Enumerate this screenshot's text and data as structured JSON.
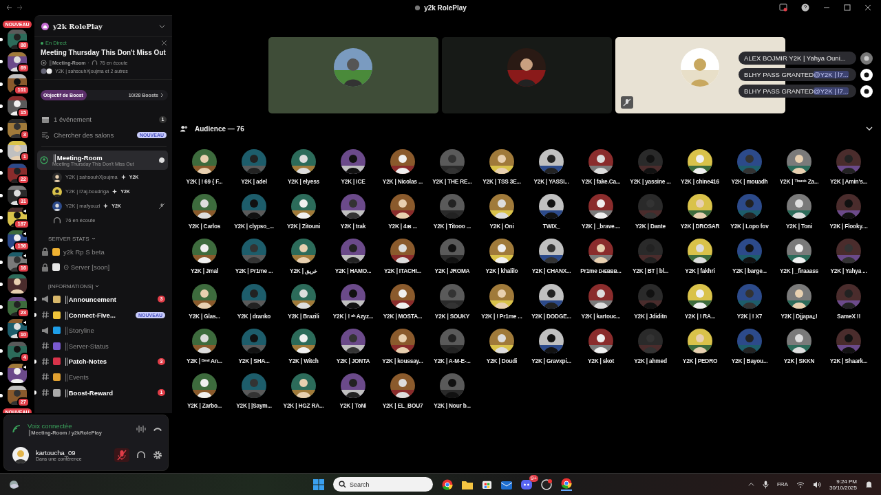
{
  "window": {
    "title": "y2k RolePlay"
  },
  "servers": {
    "top_badge": "NOUVEAU",
    "bottom_badge": "NOUVEAU",
    "items": [
      {
        "badge": "88",
        "unread": true,
        "voice": false
      },
      {
        "badge": "69",
        "unread": true,
        "voice": false
      },
      {
        "badge": "101",
        "unread": true,
        "voice": false
      },
      {
        "badge": "15",
        "unread": true,
        "voice": false
      },
      {
        "badge": "3",
        "unread": true,
        "voice": false
      },
      {
        "badge": "1",
        "unread": true,
        "voice": false
      },
      {
        "badge": "22",
        "unread": true,
        "voice": false
      },
      {
        "badge": "31",
        "unread": true,
        "voice": false
      },
      {
        "badge": "187",
        "unread": true,
        "voice": true
      },
      {
        "badge": "156",
        "unread": true,
        "voice": true
      },
      {
        "badge": "16",
        "unread": true,
        "voice": true
      },
      {
        "unread": true,
        "voice": false
      },
      {
        "badge": "23",
        "unread": true,
        "voice": false
      },
      {
        "badge": "10",
        "unread": true,
        "voice": true
      },
      {
        "badge": "4",
        "unread": true,
        "voice": false
      },
      {
        "unread": true,
        "voice": true
      },
      {
        "badge": "27",
        "unread": true,
        "voice": false
      }
    ]
  },
  "server": {
    "name": "y2k RolePlay"
  },
  "live_event": {
    "status": "En Direct",
    "title": "Meeting Thursday This Don't Miss Out",
    "channel": "║Meeting-Room",
    "separator": "·",
    "listeners": "76 en écoute",
    "participants": "Y2K | sahsouhXjoujma et 2 autres"
  },
  "boost": {
    "label": "Objectif de Boost",
    "level": 0.36,
    "count": "10/28 Boosts"
  },
  "shortcuts": [
    {
      "kind": "events",
      "label": "1 événement",
      "badge": "1"
    },
    {
      "kind": "search",
      "label": "Chercher des salons",
      "badge": "NOUVEAU"
    }
  ],
  "voice_channel": {
    "name": "║Meeting-Room",
    "topic": "Meeting Thursday This Don't Miss Out",
    "selected": true,
    "listeners": "76 en écoute",
    "members": [
      {
        "name": "Y2K | sahsouhXjoujma",
        "tag": "Y2K",
        "muted": false
      },
      {
        "name": "Y2K | l7aj.boudriga",
        "tag": "Y2K",
        "muted": false
      },
      {
        "name": "Y2K | mafyouzi",
        "tag": "Y2K",
        "muted": true
      }
    ]
  },
  "categories": [
    {
      "name": "SERVER STATS",
      "channels": [
        {
          "kind": "locked",
          "name": "y2k Rp S beta",
          "unread": false
        },
        {
          "kind": "locked",
          "name": "⊙ Server [soon]",
          "unread": false
        }
      ]
    },
    {
      "name": "[INFORMATIONS]",
      "channels": [
        {
          "kind": "announcement",
          "name": "║Announcement",
          "unread": true,
          "badge": {
            "kind": "count",
            "text": "3"
          }
        },
        {
          "kind": "text",
          "name": "║Connect-Five...",
          "unread": true,
          "badge": {
            "kind": "new",
            "text": "NOUVEAU"
          }
        },
        {
          "kind": "announcement",
          "name": "║Storyline",
          "unread": false
        },
        {
          "kind": "text",
          "name": "║Server-Status",
          "unread": false
        },
        {
          "kind": "text",
          "name": "║Patch-Notes",
          "unread": true,
          "badge": {
            "kind": "count",
            "text": "3"
          }
        },
        {
          "kind": "text",
          "name": "║Events",
          "unread": false
        },
        {
          "kind": "text",
          "name": "║Boost-Reward",
          "unread": true,
          "badge": {
            "kind": "count",
            "text": "1"
          }
        }
      ]
    }
  ],
  "voice_panel": {
    "status": "Voix connectée",
    "location": "║Meeting-Room / y2kRolePlay"
  },
  "user": {
    "name": "kartoucha_09",
    "status": "Dans une conférence",
    "mic_muted": true
  },
  "stage_tiles": [
    {
      "kind": "picture",
      "muted": false
    },
    {
      "kind": "picture",
      "muted": false
    },
    {
      "kind": "picture",
      "muted": true
    }
  ],
  "notifications": [
    {
      "text": "ALEX BOJMIR Y2K | Yahya Ouni..."
    },
    {
      "text": "BLHY PASS GRANTED",
      "mention": "@Y2K | l7..."
    },
    {
      "text": "BLHY PASS GRANTED",
      "mention": "@Y2K | l7..."
    }
  ],
  "audience": {
    "title": "Audience — 76",
    "members": [
      "Y2K | ! 69 { F...",
      "Y2K | adel",
      "Y2K | elyess",
      "Y2K | ICE",
      "Y2K | Nicolas ...",
      "Y2K | THE RE...",
      "Y2K | TSS 3E...",
      "Y2K | YASSI...",
      "Y2K | fake.Ca...",
      "Y2K | yassine ...",
      "Y2K | chine416",
      "Y2K | mouadh",
      "Y2K | ᵀʰᵃʳᵉᵇ Za...",
      "Y2K | Amin's...",
      "Y2K | Carlos",
      "Y2K | clypso_...",
      "Y2K | Zitouni",
      "Y2K | trak",
      "Y2K | 4ıв ...",
      "Y2K | Titooo ...",
      "Y2K | Oni",
      "TWIX_",
      "Y2K | _brave....",
      "Y2K | Dante",
      "Y2K | DROSAR",
      "Y2K | Lopo fov",
      "Y2K | Toni",
      "Y2K | Flooky....",
      "Y2K | Jmal",
      "Y2K | Pr1me ...",
      "Y2K | خريق",
      "Y2K | HAMO...",
      "Y2K | ITACHI...",
      "Y2K | JROMA",
      "Y2K | khalilo",
      "Y2K | CHANX...",
      "Pr1me ɪʜᴇʙʙʙ...",
      "Y2K | BT | bl...",
      "Y2K | fakhri",
      "Y2K | barge...",
      "Y2K | _firaaass",
      "Y2K | Yahya ...",
      "Y2K | Glas...",
      "Y2K | dranko",
      "Y2K | Brazili",
      "Y2K | ! ᵃʰ Azyz...",
      "Y2K | MOSTA...",
      "Y2K | SOUKY",
      "Y2K | ! Pr1me ...",
      "Y2K | DODGE...",
      "Y2K | kartouc...",
      "Y2K | Jdiditn",
      "Y2K | ! RA...",
      "Y2K | ! X7",
      "Y2K | Djjapa¿!",
      "SameX !!",
      "Y2K | ᴰᵉᵛᶦˡ An...",
      "Y2K | SHA...",
      "Y2K | Witch",
      "Y2K | JONTA",
      "Y2K | koussay...",
      "Y2K | A-M-E-...",
      "Y2K | Doudi",
      "Y2K | Gravxpi...",
      "Y2K | skot",
      "Y2K | ahmed",
      "Y2K | PEDRO",
      "Y2K | Bayou...",
      "Y2K | SKKN",
      "Y2K | Shaark...",
      "Y2K | Zarbo...",
      "Y2K | |Saym...",
      "Y2K | HGZ RA...",
      "Y2K | ToNi",
      "Y2K | EL_BOU7",
      "Y2K | Nour b..."
    ]
  },
  "taskbar": {
    "search_placeholder": "Search",
    "language": "FRA",
    "time": "9:24 PM",
    "date": "30/10/2025",
    "discord_badge": "9+"
  }
}
